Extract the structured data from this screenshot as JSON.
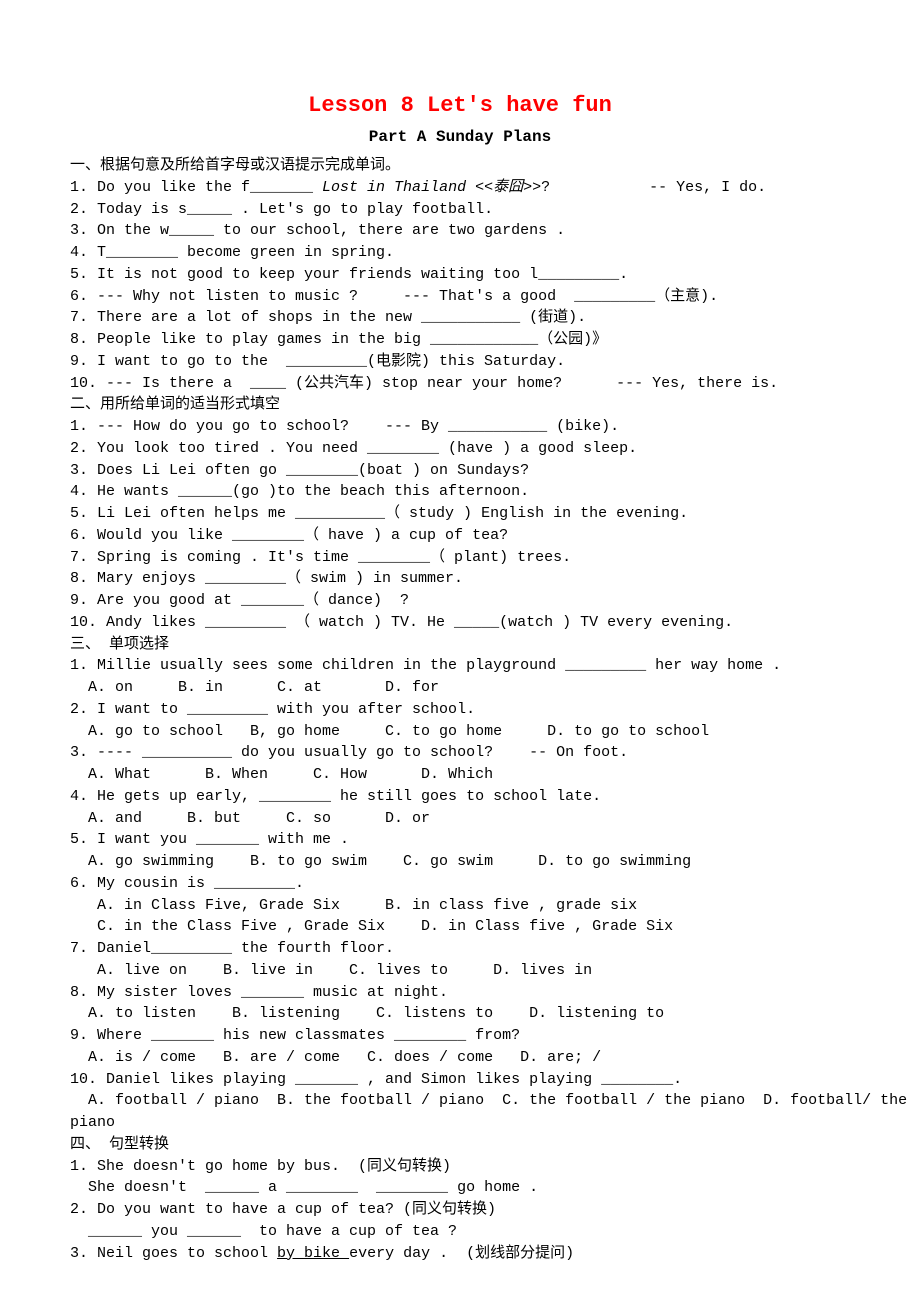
{
  "title": "Lesson 8  Let's have fun",
  "subtitle": "Part  A   Sunday Plans",
  "section1": {
    "heading": "一、根据句意及所给首字母或汉语提示完成单词。",
    "q1a": "1. Do you like the f_______ ",
    "q1b": "Lost in Thailand <<泰囧>>",
    "q1c": "?           -- Yes, I do.",
    "q2": "2. Today is s_____ . Let's go to play football.",
    "q3": "3. On the w_____ to our school, there are two gardens .",
    "q4": "4. T________ become green in spring.",
    "q5": "5. It is not good to keep your friends waiting too l_________.",
    "q6": "6. --- Why not listen to music ?     --- That's a good  _________（主意).",
    "q7": "7. There are a lot of shops in the new ___________ (街道).",
    "q8": "8. People like to play games in the big ____________（公园)》",
    "q9": "9. I want to go to the  _________(电影院) this Saturday.",
    "q10": "10. --- Is there a  ____ (公共汽车) stop near your home?      --- Yes, there is."
  },
  "section2": {
    "heading": "二、用所给单词的适当形式填空",
    "q1": "1. --- How do you go to school?    --- By ___________ (bike).",
    "q2": "2. You look too tired . You need ________ (have ) a good sleep.",
    "q3": "3. Does Li Lei often go ________(boat ) on Sundays?",
    "q4": "4. He wants ______(go )to the beach this afternoon.",
    "q5": "5. Li Lei often helps me __________（ study ) English in the evening.",
    "q6": "6. Would you like ________（ have ) a cup of tea?",
    "q7": "7. Spring is coming . It's time ________（ plant) trees.",
    "q8": "8. Mary enjoys _________（ swim ) in summer.",
    "q9": "9. Are you good at _______（ dance)  ?",
    "q10": "10. Andy likes _________ （ watch ) TV. He _____(watch ) TV every evening."
  },
  "section3": {
    "heading": "三、 单项选择",
    "q1": "1. Millie usually sees some children in the playground _________ her way home .",
    "q1opts": "  A. on     B. in      C. at       D. for",
    "q2": "2. I want to _________ with you after school.",
    "q2opts": "  A. go to school   B, go home     C. to go home     D. to go to school",
    "q3": "3. ---- __________ do you usually go to school?    -- On foot.",
    "q3opts": "  A. What      B. When     C. How      D. Which",
    "q4": "4. He gets up early, ________ he still goes to school late.",
    "q4opts": "  A. and     B. but     C. so      D. or",
    "q5": "5. I want you _______ with me .",
    "q5opts": "  A. go swimming    B. to go swim    C. go swim     D. to go swimming",
    "q6": "6. My cousin is _________.",
    "q6opts1": "   A. in Class Five, Grade Six     B. in class five , grade six",
    "q6opts2": "   C. in the Class Five , Grade Six    D. in Class five , Grade Six",
    "q7": "7. Daniel_________ the fourth floor.",
    "q7opts": "   A. live on    B. live in    C. lives to     D. lives in",
    "q8": "8. My sister loves _______ music at night.",
    "q8opts": "  A. to listen    B. listening    C. listens to    D. listening to",
    "q9": "9. Where _______ his new classmates ________ from?",
    "q9opts": "  A. is / come   B. are / come   C. does / come   D. are; /",
    "q10": "10. Daniel likes playing _______ , and Simon likes playing ________.",
    "q10opts1": "  A. football / piano  B. the football / piano  C. the football / the piano  D. football/ the",
    "q10opts2": "piano"
  },
  "section4": {
    "heading": "四、 句型转换",
    "q1": "1. She doesn't go home by bus.  (同义句转换)",
    "q1b": "  She doesn't  ______ a ________  ________ go home .",
    "q2": "2. Do you want to have a cup of tea? (同义句转换)",
    "q2b": "  ______ you ______  to have a cup of tea ?",
    "q3a": "3. Neil goes to school ",
    "q3b": "by bike ",
    "q3c": "every day .  (划线部分提问)"
  }
}
